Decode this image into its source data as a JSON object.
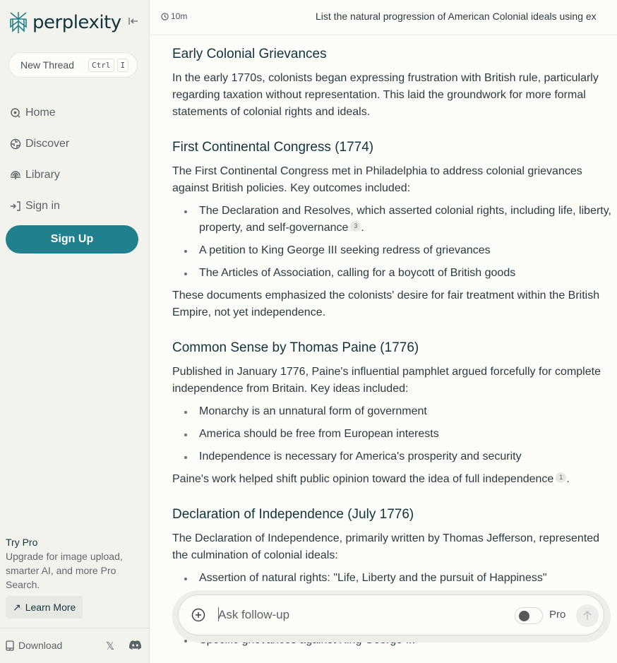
{
  "brand": {
    "name": "perplexity",
    "accent": "#20808d"
  },
  "sidebar": {
    "collapse_icon": "collapse-left-icon",
    "new_thread": {
      "label": "New Thread",
      "shortcut": [
        "Ctrl",
        "I"
      ]
    },
    "nav": [
      {
        "label": "Home",
        "icon": "home-search-icon"
      },
      {
        "label": "Discover",
        "icon": "globe-icon"
      },
      {
        "label": "Library",
        "icon": "library-icon"
      },
      {
        "label": "Sign in",
        "icon": "sign-in-icon"
      }
    ],
    "signup_label": "Sign Up",
    "try_pro": {
      "title": "Try Pro",
      "description": "Upgrade for image upload, smarter AI, and more Pro Search.",
      "learn_more": "Learn More"
    },
    "footer": {
      "download": "Download"
    }
  },
  "header": {
    "elapsed": "10m",
    "thread_title": "List the natural progression of American Colonial ideals using ex"
  },
  "content": {
    "sections": [
      {
        "heading": "Early Colonial Grievances",
        "paragraphs": [
          "In the early 1770s, colonists began expressing frustration with British rule, particularly regarding taxation without representation. This laid the groundwork for more formal statements of colonial rights and ideals."
        ]
      },
      {
        "heading": "First Continental Congress (1774)",
        "intro": "The First Continental Congress met in Philadelphia to address colonial grievances against British policies. Key outcomes included:",
        "bullets": [
          {
            "text": "The Declaration and Resolves, which asserted colonial rights, including life, liberty, property, and self-governance",
            "cite": "3"
          },
          {
            "text": "A petition to King George III seeking redress of grievances"
          },
          {
            "text": "The Articles of Association, calling for a boycott of British goods"
          }
        ],
        "outro": "These documents emphasized the colonists' desire for fair treatment within the British Empire, not yet independence."
      },
      {
        "heading": "Common Sense by Thomas Paine (1776)",
        "intro": "Published in January 1776, Paine's influential pamphlet argued forcefully for complete independence from Britain. Key ideas included:",
        "bullets": [
          {
            "text": "Monarchy is an unnatural form of government"
          },
          {
            "text": "America should be free from European interests"
          },
          {
            "text": "Independence is necessary for America's prosperity and security"
          }
        ],
        "outro": "Paine's work helped shift public opinion toward the idea of full independence",
        "outro_cite": "1"
      },
      {
        "heading": "Declaration of Independence (July 1776)",
        "intro": "The Declaration of Independence, primarily written by Thomas Jefferson, represented the culmination of colonial ideals:",
        "bullets": [
          {
            "text": "Assertion of natural rights: \"Life, Liberty and the pursuit of Happiness\""
          },
          {
            "text": "Specific grievances against King George III"
          }
        ]
      }
    ]
  },
  "followup": {
    "placeholder": "Ask follow-up",
    "value": "",
    "pro_label": "Pro",
    "pro_enabled": false
  }
}
